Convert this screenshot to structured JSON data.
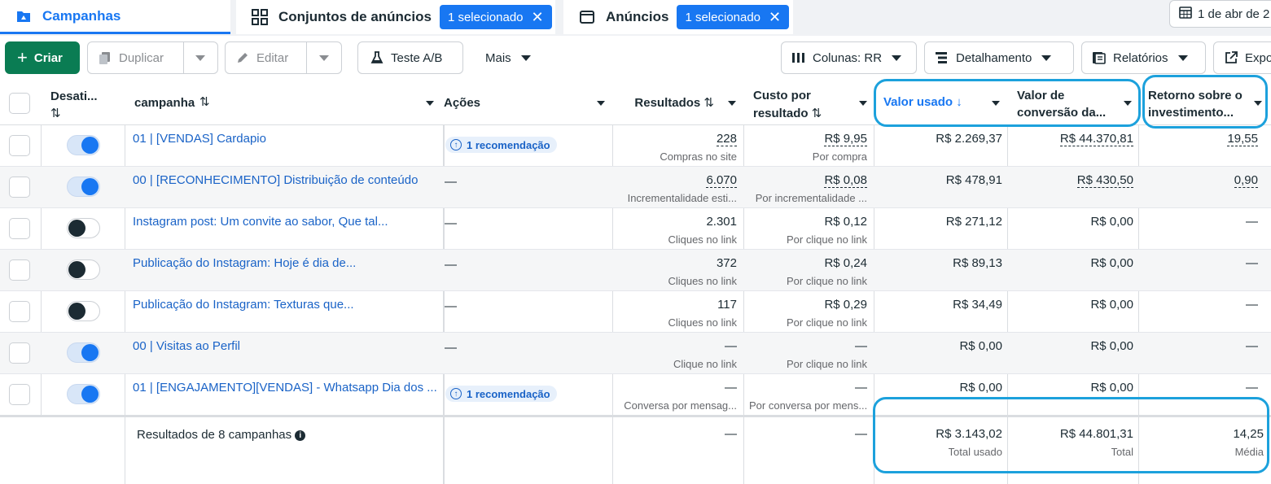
{
  "tabs": [
    {
      "label": "Campanhas"
    },
    {
      "label": "Conjuntos de anúncios",
      "chip": "1 selecionado"
    },
    {
      "label": "Anúncios",
      "chip": "1 selecionado"
    }
  ],
  "date": "1 de abr de 2",
  "toolbar": {
    "criar": "Criar",
    "duplicar": "Duplicar",
    "editar": "Editar",
    "teste_ab": "Teste A/B",
    "mais": "Mais",
    "colunas": "Colunas: RR",
    "detalhamento": "Detalhamento",
    "relatorios": "Relatórios",
    "exportar": "Expo"
  },
  "columns": {
    "desativado": "Desati...",
    "campanha": "campanha",
    "acoes": "Ações",
    "resultados": "Resultados",
    "custo_l1": "Custo por",
    "custo_l2": "resultado",
    "valor_usado": "Valor usado",
    "conv_l1": "Valor de",
    "conv_l2": "conversão da...",
    "roi_l1": "Retorno sobre o",
    "roi_l2": "investimento..."
  },
  "rows": [
    {
      "on": true,
      "name": "01 | [VENDAS] Cardapio",
      "acao": "1 recomendação",
      "res": "228",
      "res_sub": "Compras no site",
      "custo": "R$ 9,95",
      "custo_sub": "Por compra",
      "valor": "R$ 2.269,37",
      "conv": "R$ 44.370,81",
      "roi": "19,55"
    },
    {
      "on": true,
      "name": "00 | [RECONHECIMENTO] Distribuição de conteúdo",
      "acao": "—",
      "res": "6.070",
      "res_sub": "Incrementalidade esti...",
      "custo": "R$ 0,08",
      "custo_sub": "Por incrementalidade ...",
      "valor": "R$ 478,91",
      "conv": "R$ 430,50",
      "roi": "0,90"
    },
    {
      "on": false,
      "name": "Instagram post: Um convite ao sabor, Que tal...",
      "acao": "—",
      "res": "2.301",
      "res_sub": "Cliques no link",
      "custo": "R$ 0,12",
      "custo_sub": "Por clique no link",
      "valor": "R$ 271,12",
      "conv": "R$ 0,00",
      "roi": "—"
    },
    {
      "on": false,
      "name": "Publicação do Instagram: Hoje é dia de...",
      "acao": "—",
      "res": "372",
      "res_sub": "Cliques no link",
      "custo": "R$ 0,24",
      "custo_sub": "Por clique no link",
      "valor": "R$ 89,13",
      "conv": "R$ 0,00",
      "roi": "—"
    },
    {
      "on": false,
      "name": "Publicação do Instagram: Texturas que...",
      "acao": "—",
      "res": "117",
      "res_sub": "Cliques no link",
      "custo": "R$ 0,29",
      "custo_sub": "Por clique no link",
      "valor": "R$ 34,49",
      "conv": "R$ 0,00",
      "roi": "—"
    },
    {
      "on": true,
      "name": "00 | Visitas ao Perfil",
      "acao": "—",
      "res": "—",
      "res_sub": "Clique no link",
      "custo": "—",
      "custo_sub": "Por clique no link",
      "valor": "R$ 0,00",
      "conv": "R$ 0,00",
      "roi": "—"
    },
    {
      "on": true,
      "name": "01 | [ENGAJAMENTO][VENDAS] - Whatsapp Dia dos ...",
      "acao": "1 recomendação",
      "res": "—",
      "res_sub": "Conversa por mensag...",
      "custo": "—",
      "custo_sub": "Por conversa por mens...",
      "valor": "R$ 0,00",
      "conv": "R$ 0,00",
      "roi": "—"
    }
  ],
  "footer": {
    "label": "Resultados de 8 campanhas",
    "res": "—",
    "custo": "—",
    "valor": "R$ 3.143,02",
    "valor_sub": "Total usado",
    "conv": "R$ 44.801,31",
    "conv_sub": "Total",
    "roi": "14,25",
    "roi_sub": "Média"
  },
  "colors": {
    "accent": "#1877f2",
    "create": "#0a7c53",
    "highlight": "#1ca1dc"
  }
}
